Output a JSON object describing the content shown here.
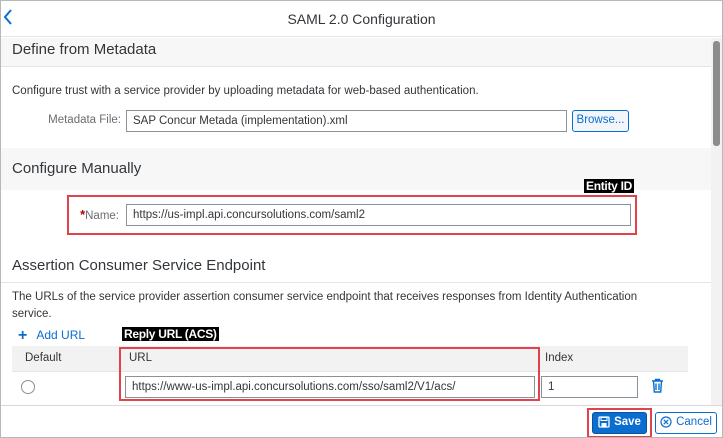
{
  "header": {
    "title": "SAML 2.0 Configuration",
    "back_icon": "chevron-left-icon"
  },
  "metadata_section": {
    "title": "Define from Metadata",
    "description": "Configure trust with a service provider by uploading metadata for web-based authentication.",
    "file_label": "Metadata File:",
    "file_value": "SAP Concur Metada (implementation).xml",
    "browse_label": "Browse..."
  },
  "manual_section": {
    "title": "Configure Manually",
    "name_label": "Name:",
    "required_marker": "*",
    "name_value": "https://us-impl.api.concursolutions.com/saml2",
    "entity_callout": "Entity ID"
  },
  "acs_section": {
    "title": "Assertion Consumer Service Endpoint",
    "description_line1": "The URLs of the service provider assertion consumer service endpoint that receives responses from Identity Authentication",
    "description_line2": "service.",
    "add_url_label": "Add URL",
    "reply_callout": "Reply URL (ACS)",
    "columns": [
      "Default",
      "URL",
      "Index"
    ],
    "rows": [
      {
        "url": "https://www-us-impl.api.concursolutions.com/sso/saml2/V1/acs/",
        "index": "1"
      }
    ]
  },
  "footer": {
    "save_label": "Save",
    "cancel_label": "Cancel"
  },
  "colors": {
    "accent": "#0a6ed1",
    "highlight": "#e0434b"
  }
}
